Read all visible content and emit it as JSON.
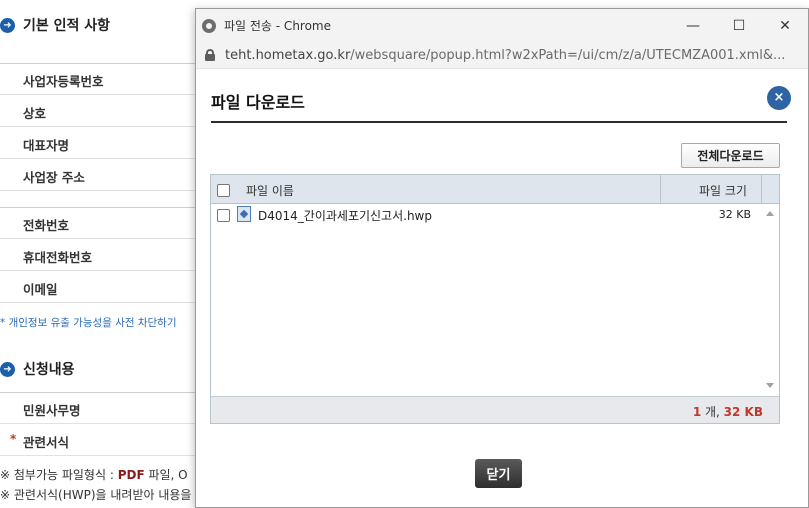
{
  "background": {
    "section1_title": "기본 인적 사항",
    "section1_rows": [
      "사업자등록번호",
      "상호",
      "대표자명",
      "사업장 주소"
    ],
    "section1b_rows": [
      "전화번호",
      "휴대전화번호",
      "이메일"
    ],
    "privacy_note": "* 개인정보 유출 가능성을 사전 차단하기",
    "section2_title": "신청내용",
    "section2_row1": "민원사무명",
    "section2_row2_marker": "*",
    "section2_row2": "관련서식",
    "note1_prefix": "※ 첨부가능 파일형식 : ",
    "note1_pdf": "PDF",
    "note1_suffix": " 파일, O",
    "note2": "※ 관련서식(HWP)을 내려받아 내용을"
  },
  "window": {
    "title": "파일 전송 - Chrome",
    "min_symbol": "—",
    "max_symbol": "☐",
    "close_symbol": "✕",
    "url_host": "teht.hometax.go.kr",
    "url_path": "/websquare/popup.html?w2xPath=/ui/cm/z/a/UTECMZA001.xml&..."
  },
  "dialog": {
    "title": "파일 다운로드",
    "close_symbol": "×",
    "download_all_label": "전체다운로드",
    "columns": {
      "name": "파일 이름",
      "size": "파일 크기"
    },
    "files": [
      {
        "name": "D4014_간이과세포기신고서.hwp",
        "size": "32 KB"
      }
    ],
    "summary": {
      "count": "1",
      "count_unit": " 개, ",
      "total": "32 KB"
    },
    "close_button_label": "닫기"
  },
  "colors": {
    "accent_blue": "#2e63a4",
    "summary_red": "#c0392b",
    "pdf_red": "#8b1a1a"
  },
  "icons": [
    "arrow-right-circle-icon",
    "chrome-icon",
    "lock-icon",
    "close-circle-icon",
    "hwp-file-icon",
    "checkbox-icon",
    "scroll-up-icon",
    "scroll-down-icon"
  ]
}
